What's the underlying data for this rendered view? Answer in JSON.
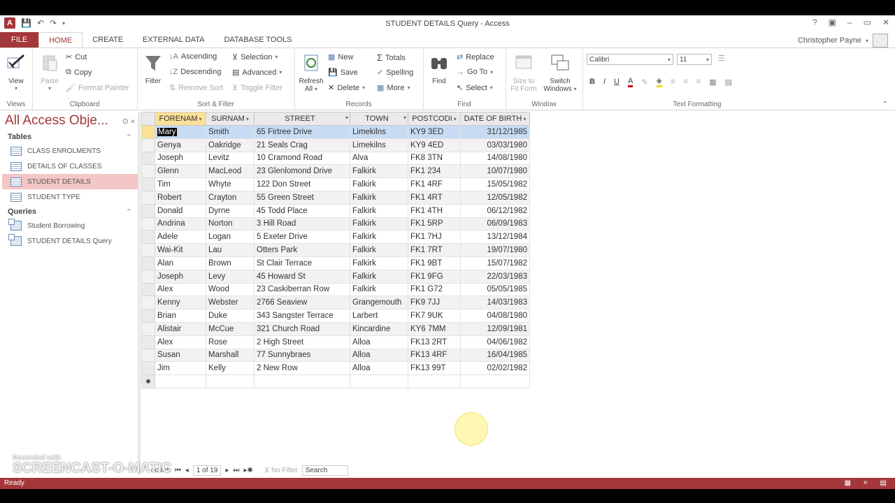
{
  "window": {
    "title": "STUDENT DETAILS Query - Access",
    "user": "Christopher Payne",
    "help": "?",
    "minimize": "–",
    "restore": "▭",
    "close": "✕"
  },
  "tabs": [
    "FILE",
    "HOME",
    "CREATE",
    "EXTERNAL DATA",
    "DATABASE TOOLS"
  ],
  "ribbon": {
    "views": {
      "view": "View",
      "label": "Views"
    },
    "clipboard": {
      "paste": "Paste",
      "cut": "Cut",
      "copy": "Copy",
      "format_painter": "Format Painter",
      "label": "Clipboard"
    },
    "sort_filter": {
      "filter": "Filter",
      "ascending": "Ascending",
      "descending": "Descending",
      "remove_sort": "Remove Sort",
      "selection": "Selection",
      "advanced": "Advanced",
      "toggle_filter": "Toggle Filter",
      "label": "Sort & Filter"
    },
    "records": {
      "refresh": "Refresh",
      "refresh_all": "All",
      "new": "New",
      "save": "Save",
      "delete": "Delete",
      "totals": "Totals",
      "spelling": "Spelling",
      "more": "More",
      "label": "Records"
    },
    "find": {
      "find": "Find",
      "replace": "Replace",
      "goto": "Go To",
      "select": "Select",
      "label": "Find"
    },
    "window": {
      "size_to_fit": "Size to",
      "size_to_fit2": "Fit Form",
      "switch": "Switch",
      "switch2": "Windows",
      "label": "Window"
    },
    "text_formatting": {
      "font": "Calibri",
      "size": "11",
      "label": "Text Formatting"
    }
  },
  "nav": {
    "title": "All Access Obje...",
    "tables_label": "Tables",
    "tables": [
      "CLASS ENROLMENTS",
      "DETAILS OF CLASSES",
      "STUDENT DETAILS",
      "STUDENT TYPE"
    ],
    "queries_label": "Queries",
    "queries": [
      "Student Borrowing",
      "STUDENT DETAILS Query"
    ]
  },
  "datasheet": {
    "columns": [
      "FORENAM",
      "SURNAM",
      "STREET",
      "TOWN",
      "POSTCODI",
      "DATE OF BIRTH"
    ],
    "rows": [
      [
        "Mary",
        "Smith",
        "65 Firtree Drive",
        "Limekilns",
        "KY9 3ED",
        "31/12/1985"
      ],
      [
        "Genya",
        "Oakridge",
        "21 Seals Crag",
        "Limekilns",
        "KY9 4ED",
        "03/03/1980"
      ],
      [
        "Joseph",
        "Levitz",
        "10 Cramond Road",
        "Alva",
        "FK8 3TN",
        "14/08/1980"
      ],
      [
        "Glenn",
        "MacLeod",
        "23 Glenlomond Drive",
        "Falkirk",
        "FK1 234",
        "10/07/1980"
      ],
      [
        "Tim",
        "Whyte",
        "122 Don Street",
        "Falkirk",
        "FK1 4RF",
        "15/05/1982"
      ],
      [
        "Robert",
        "Crayton",
        "55 Green Street",
        "Falkirk",
        "FK1 4RT",
        "12/05/1982"
      ],
      [
        "Donald",
        "Dyrne",
        "45 Todd Place",
        "Falkirk",
        "FK1 4TH",
        "06/12/1982"
      ],
      [
        "Andrina",
        "Norton",
        "3 Hill Road",
        "Falkirk",
        "FK1 5RP",
        "06/09/1983"
      ],
      [
        "Adele",
        "Logan",
        "5 Exeter Drive",
        "Falkirk",
        "FK1 7HJ",
        "13/12/1984"
      ],
      [
        "Wai-Kit",
        "Lau",
        "Otters Park",
        "Falkirk",
        "FK1 7RT",
        "19/07/1980"
      ],
      [
        "Alan",
        "Brown",
        "St Clair Terrace",
        "Falkirk",
        "FK1 9BT",
        "15/07/1982"
      ],
      [
        "Joseph",
        "Levy",
        "45 Howard St",
        "Falkirk",
        "FK1 9FG",
        "22/03/1983"
      ],
      [
        "Alex",
        "Wood",
        "23 Caskiberran Row",
        "Falkirk",
        "FK1 G72",
        "05/05/1985"
      ],
      [
        "Kenny",
        "Webster",
        "2766 Seaview",
        "Grangemouth",
        "FK9 7JJ",
        "14/03/1983"
      ],
      [
        "Brian",
        "Duke",
        "343 Sangster Terrace",
        "Larbert",
        "FK7 9UK",
        "04/08/1980"
      ],
      [
        "Alistair",
        "McCue",
        "321 Church Road",
        "Kincardine",
        "KY6 7MM",
        "12/09/1981"
      ],
      [
        "Alex",
        "Rose",
        "2 High Street",
        "Alloa",
        "FK13 2RT",
        "04/06/1982"
      ],
      [
        "Susan",
        "Marshall",
        "77 Sunnybraes",
        "Alloa",
        "FK13 4RF",
        "16/04/1985"
      ],
      [
        "Jim",
        "Kelly",
        "2 New Row",
        "Alloa",
        "FK13 99T",
        "02/02/1982"
      ]
    ],
    "new_row_marker": "✱"
  },
  "record_nav": {
    "label": "ecord:",
    "position": "1 of 19",
    "no_filter": "No Filter",
    "search": "Search"
  },
  "status": {
    "text": "Ready"
  },
  "watermark": {
    "line1": "Recorded with",
    "line2": "SCREENCAST-O-MATIC"
  }
}
